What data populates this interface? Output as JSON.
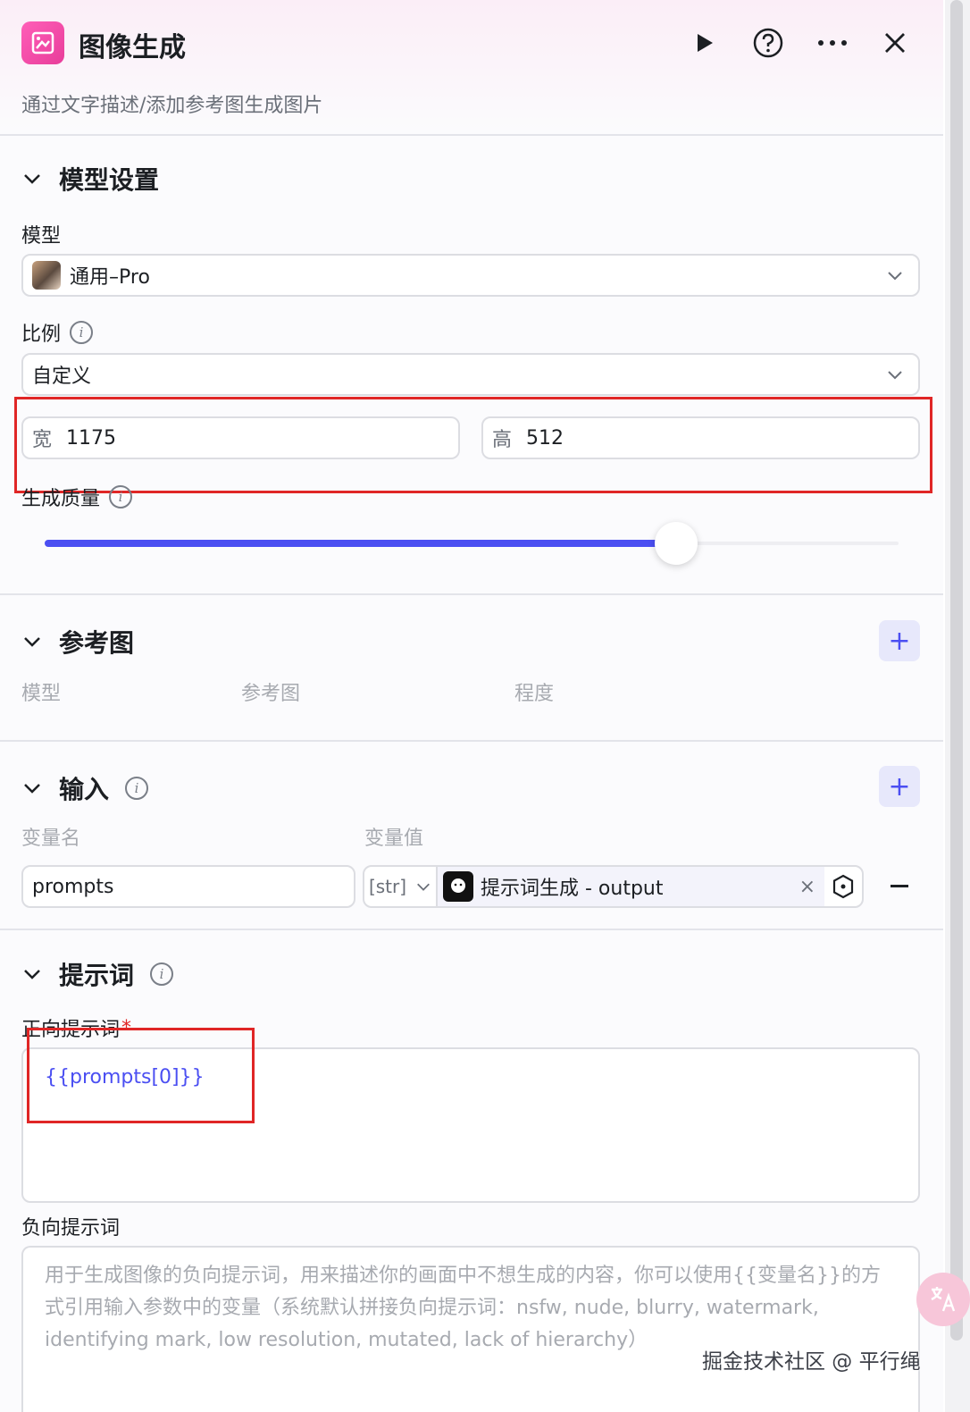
{
  "header": {
    "title": "图像生成",
    "subtitle": "通过文字描述/添加参考图生成图片"
  },
  "model_settings": {
    "section_title": "模型设置",
    "model_label": "模型",
    "model_value": "通用–Pro",
    "ratio_label": "比例",
    "ratio_value": "自定义",
    "width_prefix": "宽",
    "width_value": "1175",
    "height_prefix": "高",
    "height_value": "512",
    "quality_label": "生成质量",
    "quality_level": 0.74
  },
  "reference": {
    "section_title": "参考图",
    "columns": [
      "模型",
      "参考图",
      "程度"
    ]
  },
  "inputs": {
    "section_title": "输入",
    "columns": [
      "变量名",
      "变量值"
    ],
    "row": {
      "name": "prompts",
      "type": "[str]",
      "source": "提示词生成 - output"
    }
  },
  "prompts": {
    "section_title": "提示词",
    "positive_label": "正向提示词",
    "required_mark": "*",
    "positive_value": "{{prompts[0]}}",
    "negative_label": "负向提示词",
    "negative_placeholder": "用于生成图像的负向提示词，用来描述你的画面中不想生成的内容，你可以使用{{变量名}}的方式引用输入参数中的变量（系统默认拼接负向提示词：nsfw, nude, blurry, watermark, identifying mark, low resolution, mutated, lack of hierarchy）"
  },
  "watermark": "掘金技术社区 @ 平行绳",
  "colors": {
    "accent": "#4b4ff2",
    "brand_pink": "#e83d9a",
    "highlight_red": "#e02626"
  }
}
